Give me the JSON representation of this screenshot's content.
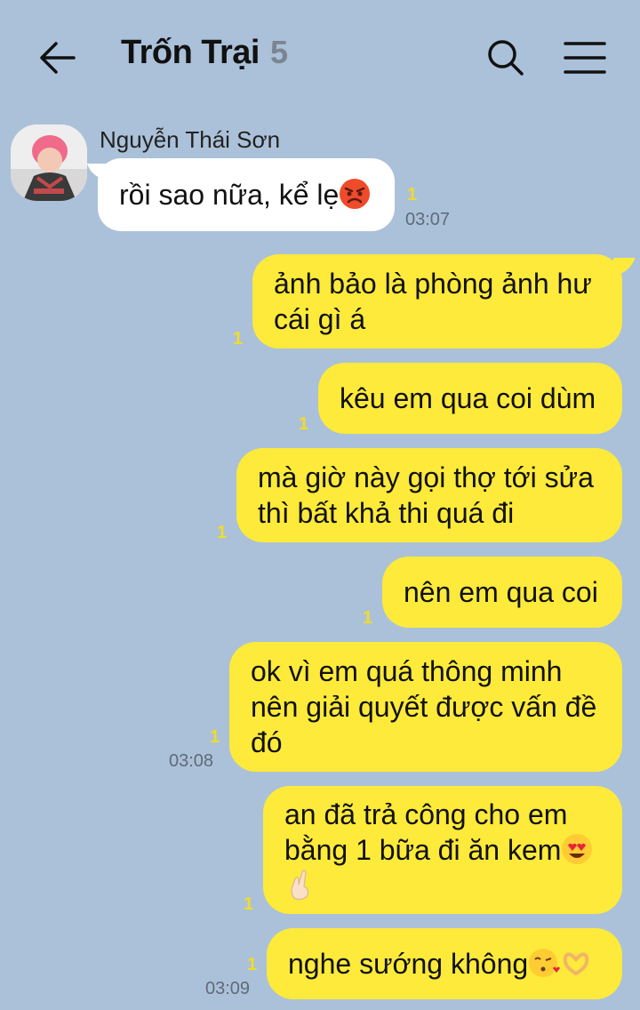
{
  "header": {
    "title": "Trốn Trại",
    "member_count": "5"
  },
  "incoming": {
    "sender": "Nguyễn Thái Sơn",
    "text": "rồi sao nữa, kể lẹ",
    "emoji": "angry-face",
    "unread": "1",
    "time": "03:07"
  },
  "outgoing": [
    {
      "lines": [
        "ảnh bảo là phòng ảnh hư",
        "cái gì á"
      ],
      "unread": "1"
    },
    {
      "lines": [
        "kêu em qua coi dùm"
      ],
      "unread": "1"
    },
    {
      "lines": [
        "mà giờ này gọi thợ tới sửa",
        "thì bất khả thi quá đi"
      ],
      "unread": "1"
    },
    {
      "lines": [
        "nên em qua coi"
      ],
      "unread": "1"
    },
    {
      "lines": [
        "ok vì em quá thông minh",
        "nên giải quyết được vấn đề",
        "đó"
      ],
      "unread": "1",
      "time": "03:08"
    },
    {
      "lines": [
        "an đã trả công cho em",
        "bằng 1 bữa đi ăn kem"
      ],
      "emojis": [
        "heart-eyes-face",
        "crossed-fingers-hand"
      ],
      "unread": "1"
    },
    {
      "lines": [
        "nghe sướng không"
      ],
      "emojis": [
        "kissing-face",
        "heart-hands"
      ],
      "unread": "1",
      "time": "03:09"
    }
  ],
  "colors": {
    "background": "#abc1d9",
    "outgoing_bubble": "#fdea3a",
    "incoming_bubble": "#ffffff",
    "unread_count": "#f0dc2a"
  }
}
